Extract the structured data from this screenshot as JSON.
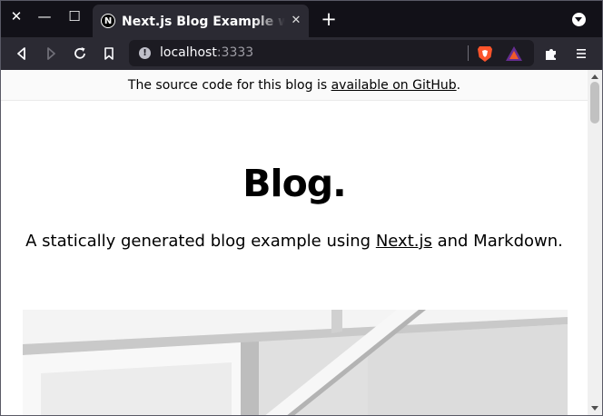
{
  "window": {
    "close_glyph": "✕",
    "minimize_glyph": "—",
    "maximize_glyph": "☐"
  },
  "tab": {
    "favicon_letter": "N",
    "title": "Next.js Blog Example with Markdown",
    "close_glyph": "✕"
  },
  "toolbar": {
    "new_tab_glyph": "+"
  },
  "address_bar": {
    "host": "localhost",
    "port": ":3333",
    "info_glyph": "!"
  },
  "banner": {
    "prefix": "The source code for this blog is ",
    "link_text": "available on GitHub",
    "suffix": "."
  },
  "hero": {
    "title": "Blog.",
    "subtitle_prefix": "A statically generated blog example using ",
    "subtitle_link": "Next.js",
    "subtitle_suffix": " and Markdown."
  },
  "colors": {
    "titlebar_bg": "#121118",
    "toolbar_bg": "#2b2a33",
    "urlbar_bg": "#1c1b22",
    "page_bg": "#ffffff",
    "banner_bg": "#fafafa",
    "brave_orange": "#fb542b",
    "rewards_purple": "#662d91"
  }
}
